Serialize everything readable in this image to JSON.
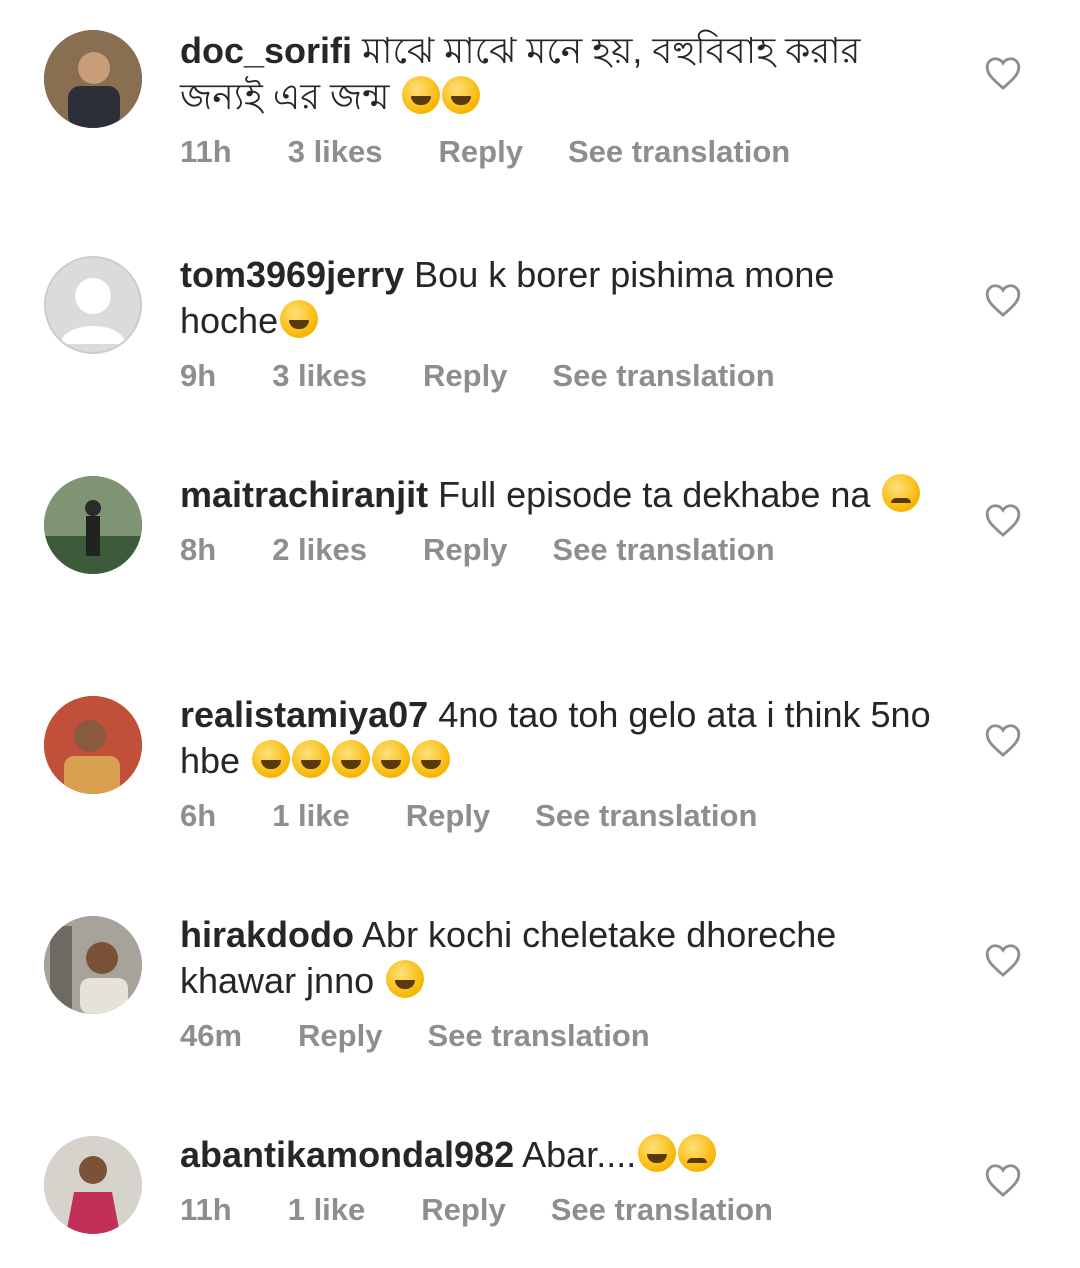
{
  "comments": [
    {
      "username": "doc_sorifi",
      "text": "মাঝে মাঝে মনে হয়, বহুবিবাহ করার জন্যই এর জন্ম",
      "emojis": [
        "rolling-laughing",
        "tears-of-joy"
      ],
      "time": "11h",
      "likes": "3 likes",
      "reply": "Reply",
      "translate": "See translation"
    },
    {
      "username": "tom3969jerry",
      "text": "Bou k borer pishima mone hoche",
      "emojis": [
        "tears-of-joy"
      ],
      "time": "9h",
      "likes": "3 likes",
      "reply": "Reply",
      "translate": "See translation"
    },
    {
      "username": "maitrachiranjit",
      "text": "Full episode ta dekhabe na",
      "emojis": [
        "crying"
      ],
      "time": "8h",
      "likes": "2 likes",
      "reply": "Reply",
      "translate": "See translation"
    },
    {
      "username": "realistamiya07",
      "text": "4no tao toh gelo ata i think 5no hbe",
      "emojis": [
        "tears-of-joy",
        "tears-of-joy",
        "tears-of-joy",
        "tears-of-joy",
        "tears-of-joy"
      ],
      "time": "6h",
      "likes": "1 like",
      "reply": "Reply",
      "translate": "See translation"
    },
    {
      "username": "hirakdodo",
      "text": "Abr kochi cheletake dhoreche khawar jnno",
      "emojis": [
        "tears-of-joy"
      ],
      "time": "46m",
      "likes": "",
      "reply": "Reply",
      "translate": "See translation"
    },
    {
      "username": "abantikamondal982",
      "text": "Abar....",
      "emojis": [
        "tears-of-joy",
        "crying"
      ],
      "time": "11h",
      "likes": "1 like",
      "reply": "Reply",
      "translate": "See translation"
    }
  ],
  "icons": {
    "like": "heart-outline-icon"
  },
  "colors": {
    "text": "#262626",
    "meta": "#8e8e8e",
    "background": "#ffffff"
  }
}
